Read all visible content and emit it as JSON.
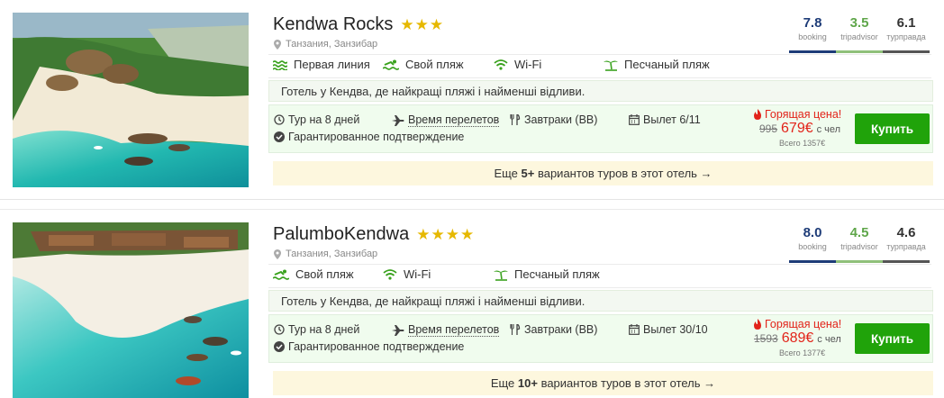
{
  "hotels": [
    {
      "name": "Kendwa Rocks",
      "stars": 3,
      "location": "Танзания, Занзибар",
      "ratings": [
        {
          "value": "7.8",
          "label": "booking",
          "color": "#1e3c78"
        },
        {
          "value": "3.5",
          "label": "tripadvisor",
          "color": "#5fa64a"
        },
        {
          "value": "6.1",
          "label": "турправда",
          "color": "#333333"
        }
      ],
      "features": [
        {
          "label": "Первая линия",
          "icon": "waves-icon"
        },
        {
          "label": "Свой пляж",
          "icon": "swimmer-icon"
        },
        {
          "label": "Wi-Fi",
          "icon": "wifi-icon"
        },
        {
          "label": "Песчаный пляж",
          "icon": "palm-tree-icon"
        }
      ],
      "description": "Готель у Кендва, де найкращі пляжі і найменші відливи.",
      "tour": {
        "duration": "Тур на 8 дней",
        "flight": "Время перелетов",
        "meals": "Завтраки (BB)",
        "departure": "Вылет 6/11",
        "guarantee": "Гарантированное подтверждение"
      },
      "price": {
        "hot_label": "Горящая цена!",
        "old": "995",
        "new": "679€",
        "per_person": "с чел",
        "total": "Всего 1357€"
      },
      "buy_label": "Купить",
      "more": {
        "prefix": "Еще ",
        "count": "5+",
        "suffix": " вариантов туров в этот отель →"
      }
    },
    {
      "name": "PalumboKendwa",
      "stars": 4,
      "location": "Танзания, Занзибар",
      "ratings": [
        {
          "value": "8.0",
          "label": "booking",
          "color": "#1e3c78"
        },
        {
          "value": "4.5",
          "label": "tripadvisor",
          "color": "#5fa64a"
        },
        {
          "value": "4.6",
          "label": "турправда",
          "color": "#333333"
        }
      ],
      "features": [
        {
          "label": "Свой пляж",
          "icon": "swimmer-icon"
        },
        {
          "label": "Wi-Fi",
          "icon": "wifi-icon"
        },
        {
          "label": "Песчаный пляж",
          "icon": "palm-tree-icon"
        }
      ],
      "description": "Готель у Кендва, де найкращі пляжі і найменші відливи.",
      "tour": {
        "duration": "Тур на 8 дней",
        "flight": "Время перелетов",
        "meals": "Завтраки (BB)",
        "departure": "Вылет 30/10",
        "guarantee": "Гарантированное подтверждение"
      },
      "price": {
        "hot_label": "Горящая цена!",
        "old": "1593",
        "new": "689€",
        "per_person": "с чел",
        "total": "Всего 1377€"
      },
      "buy_label": "Купить",
      "more": {
        "prefix": "Еще ",
        "count": "10+",
        "suffix": " вариантов туров в этот отель →"
      }
    }
  ],
  "colors": {
    "accent_green": "#20a30a",
    "hot_red": "#e2231a",
    "star_yellow": "#e6b800",
    "icon_green": "#3aa21e",
    "more_bg": "#fdf7de"
  }
}
